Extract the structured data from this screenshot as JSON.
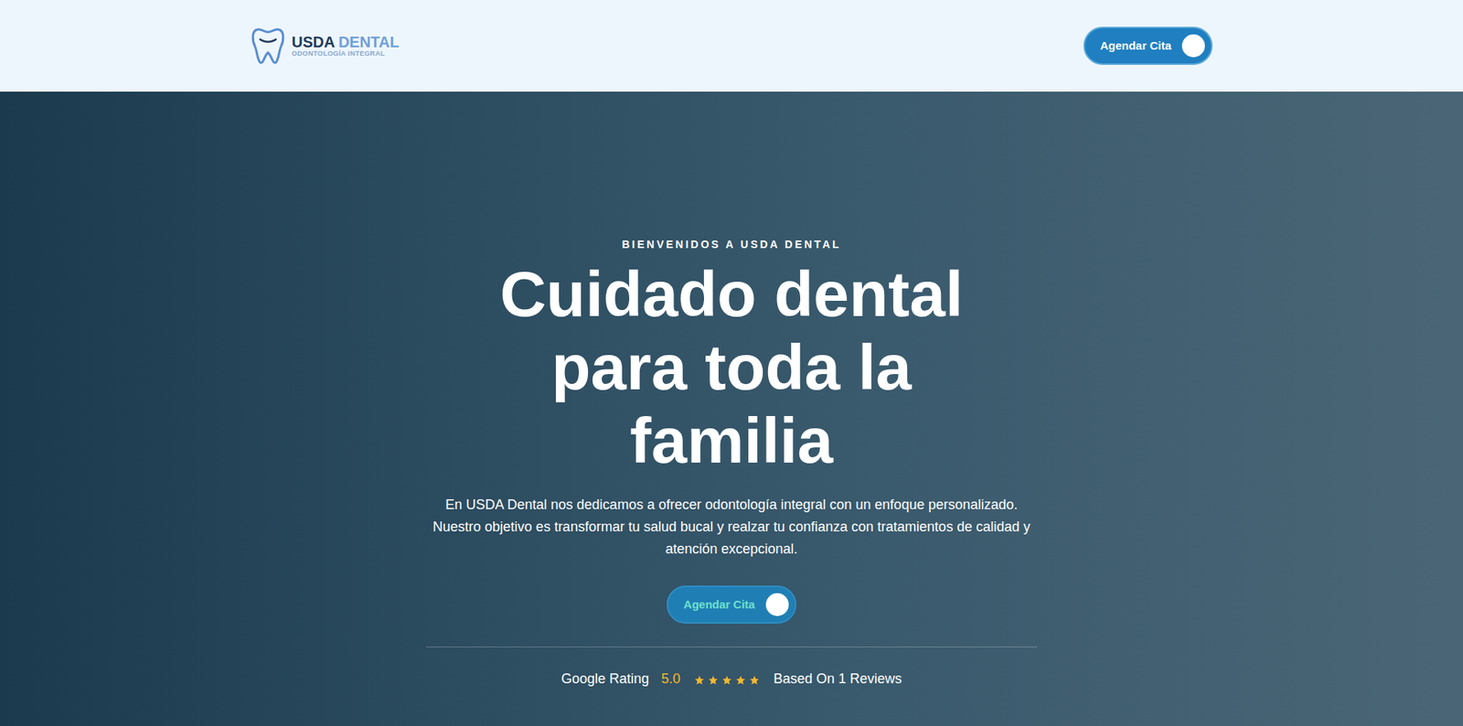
{
  "header": {
    "logo": {
      "brand_main": "USDA",
      "brand_accent": "DENTAL",
      "tagline": "ODONTOLOGÍA INTEGRAL"
    },
    "cta": "Agendar Cita"
  },
  "hero": {
    "eyebrow": "BIENVENIDOS A USDA DENTAL",
    "title_lines": [
      "Cuidado dental",
      "para toda la",
      "familia"
    ],
    "description": "En USDA Dental nos dedicamos a ofrecer odontología integral con un enfoque personalizado. Nuestro objetivo es transformar tu salud bucal y realzar tu confianza con tratamientos de calidad y atención excepcional.",
    "cta": "Agendar Cita",
    "rating": {
      "label": "Google Rating",
      "score": "5.0",
      "stars": 5,
      "reviews": "Based On 1 Reviews"
    }
  }
}
